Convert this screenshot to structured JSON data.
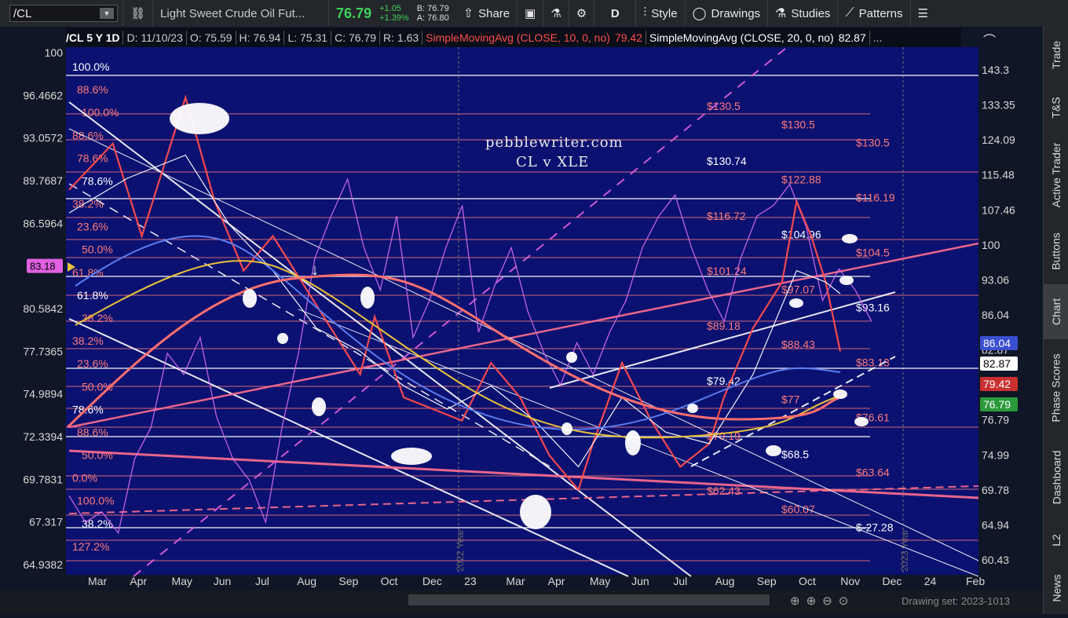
{
  "toolbar": {
    "symbol": "/CL",
    "description": "Light Sweet Crude Oil Fut...",
    "last": "76.79",
    "change": "+1.05",
    "change_pct": "+1.39%",
    "bid": "B: 76.79",
    "ask": "A: 76.80",
    "share": "Share",
    "period": "D",
    "style": "Style",
    "drawings": "Drawings",
    "studies": "Studies",
    "patterns": "Patterns"
  },
  "header": {
    "symbol_period": "/CL 5 Y 1D",
    "date": "D: 11/10/23",
    "open": "O: 75.59",
    "high": "H: 76.94",
    "low": "L: 75.31",
    "close": "C: 76.79",
    "range": "R: 1.63",
    "sma10_label": "SimpleMovingAvg (CLOSE, 10, 0, no)",
    "sma10_value": "79.42",
    "sma20_label": "SimpleMovingAvg (CLOSE, 20, 0, no)",
    "sma20_value": "82.87",
    "more": "..."
  },
  "watermark": {
    "line1": "pebblewriter.com",
    "line2": "CL v XLE"
  },
  "right_rail": [
    "Trade",
    "T&S",
    "Active Trader",
    "Buttons",
    "Chart",
    "Phase Scores",
    "Dashboard",
    "L2",
    "News"
  ],
  "drawing_set": "Drawing set: 2023-1013",
  "colors": {
    "price": "#ff4d4d",
    "xle": "#d46cf0",
    "sma_blue": "#5b7cf0",
    "sma_yellow": "#e8c23a",
    "fib": "#ff7a7a",
    "bg": "#0f1626"
  },
  "chart_data": {
    "type": "line",
    "x_ticks": [
      "Mar",
      "Apr",
      "May",
      "Jun",
      "Jul",
      "Aug",
      "Sep",
      "Oct",
      "Dec",
      "23",
      "Mar",
      "Apr",
      "May",
      "Jun",
      "Jul",
      "Aug",
      "Sep",
      "Oct",
      "Nov",
      "Dec",
      "24",
      "Feb"
    ],
    "year_markers": [
      "2022 Year",
      "2023 Year"
    ],
    "left_axis": [
      "100",
      "96.4662",
      "93.0572",
      "89.7687",
      "86.5964",
      "83.18",
      "80.5842",
      "77.7365",
      "74.9894",
      "72.3394",
      "69.7831",
      "67.317",
      "64.9382"
    ],
    "left_axis_highlight": "83.18",
    "right_axis": [
      "143.3",
      "133.35",
      "124.09",
      "115.48",
      "107.46",
      "100",
      "93.06",
      "86.04",
      "82.87",
      "79.42",
      "76.79",
      "74.99",
      "69.78",
      "64.94",
      "60.43"
    ],
    "right_axis_ranges": {
      "xle": [
        56,
        150
      ]
    },
    "right_badges": [
      {
        "text": "86.04",
        "color": "#3a4fd0"
      },
      {
        "text": "82.87",
        "color": "#ffffff"
      },
      {
        "text": "79.42",
        "color": "#c93030"
      },
      {
        "text": "76.79",
        "color": "#2a9a3a"
      }
    ],
    "fib_left_labels": [
      "100.0%",
      "88.6%",
      "100.0%",
      "88.6%",
      "78.6%",
      "78.6%",
      "38.2%",
      "23.6%",
      "50.0%",
      "61.8%",
      "61.8%",
      "38.2%",
      "38.2%",
      "23.6%",
      "50.0%",
      "78.6%",
      "88.6%",
      "50.0%",
      "0.0%",
      "100.0%",
      "38.2%",
      "127.2%"
    ],
    "price_level_labels": [
      "$130.5",
      "$130.5",
      "$130.5",
      "$130.74",
      "$122.88",
      "$116.19",
      "$116.72",
      "$104.96",
      "$104.5",
      "$101.24",
      "$97.07",
      "$93.16",
      "$89.18",
      "$88.43",
      "$83.13",
      "$79.42",
      "$77",
      "$76.61",
      "$70.19",
      "$68.5",
      "$63.64",
      "$62.43",
      "$60.07",
      "$-27.28"
    ],
    "series": [
      {
        "name": "SimpleMovingAvg (CLOSE, 10, 0, no)",
        "color": "#ff4d4d",
        "points": [
          [
            0,
            92
          ],
          [
            3,
            96
          ],
          [
            5,
            88
          ],
          [
            8,
            100
          ],
          [
            10,
            91
          ],
          [
            12,
            85
          ],
          [
            14,
            88
          ],
          [
            16,
            84
          ],
          [
            18,
            80
          ],
          [
            20,
            76
          ],
          [
            21,
            81
          ],
          [
            23,
            74
          ],
          [
            25,
            73
          ],
          [
            27,
            72
          ],
          [
            29,
            77
          ],
          [
            31,
            74
          ],
          [
            33,
            69
          ],
          [
            35,
            66
          ],
          [
            36,
            70
          ],
          [
            38,
            77
          ],
          [
            40,
            72
          ],
          [
            42,
            68
          ],
          [
            44,
            70
          ],
          [
            45,
            74
          ],
          [
            47,
            80
          ],
          [
            49,
            84
          ],
          [
            50,
            91
          ],
          [
            51,
            88
          ],
          [
            52,
            84
          ],
          [
            53,
            78
          ]
        ]
      },
      {
        "name": "SimpleMovingAvg (CLOSE, 20, 0, no)",
        "color": "#ffffff",
        "points": [
          [
            0,
            90
          ],
          [
            4,
            93
          ],
          [
            8,
            95
          ],
          [
            11,
            89
          ],
          [
            14,
            85
          ],
          [
            17,
            80
          ],
          [
            20,
            78
          ],
          [
            23,
            75
          ],
          [
            26,
            73
          ],
          [
            29,
            75
          ],
          [
            32,
            72
          ],
          [
            35,
            68
          ],
          [
            38,
            74
          ],
          [
            41,
            71
          ],
          [
            44,
            70
          ],
          [
            47,
            76
          ],
          [
            50,
            85
          ],
          [
            52,
            84
          ],
          [
            53,
            83
          ]
        ]
      }
    ],
    "comparison": {
      "name": "XLE",
      "axis": "right",
      "color": "#d46cf0",
      "values": [
        65,
        60,
        62,
        58,
        72,
        78,
        92,
        88,
        95,
        80,
        72,
        68,
        60,
        78,
        92,
        110,
        118,
        125,
        112,
        104,
        118,
        95,
        102,
        112,
        120,
        96,
        105,
        112,
        100,
        92,
        86,
        94,
        88,
        96,
        102,
        112,
        118,
        122,
        112,
        104,
        98,
        110,
        118,
        120,
        124,
        116,
        102,
        108,
        104,
        98
      ]
    },
    "ylim_price": [
      60,
      103
    ]
  }
}
